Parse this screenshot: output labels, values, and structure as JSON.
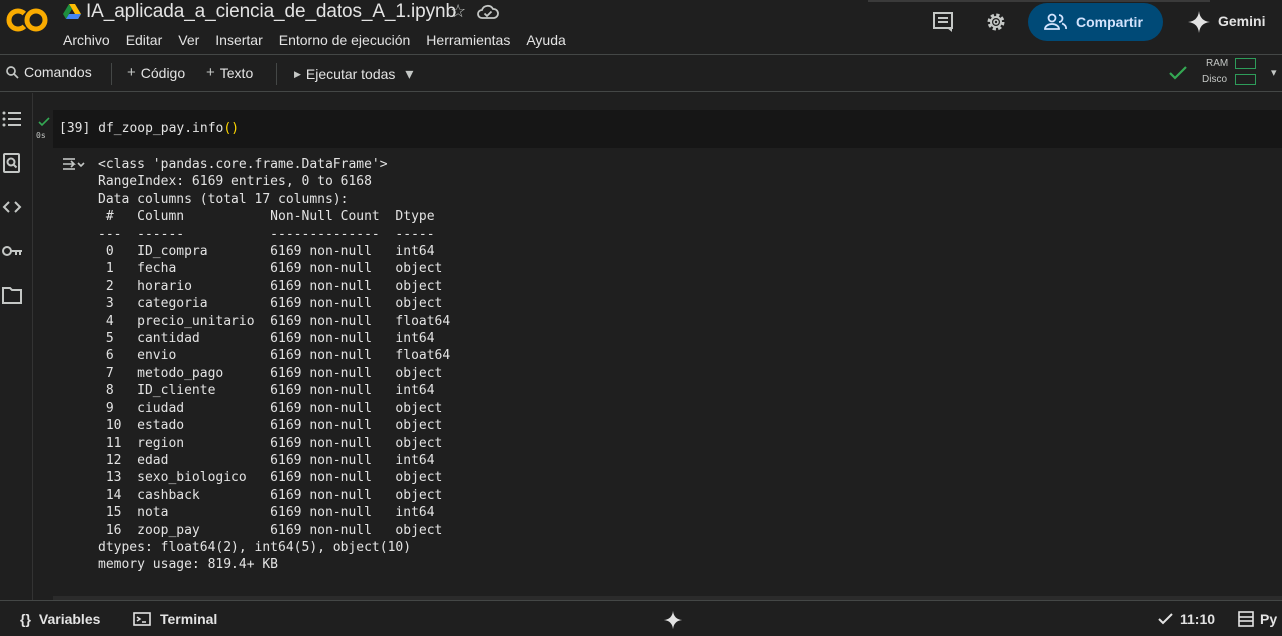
{
  "app": {
    "logo_text": "CO",
    "notebook_title": "IA_aplicada_a_ciencia_de_datos_A_1.ipynb"
  },
  "menu": [
    "Archivo",
    "Editar",
    "Ver",
    "Insertar",
    "Entorno de ejecución",
    "Herramientas",
    "Ayuda"
  ],
  "header": {
    "share_label": "Compartir",
    "gemini_label": "Gemini"
  },
  "toolbar": {
    "commands_label": "Comandos",
    "code_label": "Código",
    "text_label": "Texto",
    "run_all_label": "Ejecutar todas",
    "ram_label": "RAM",
    "disk_label": "Disco"
  },
  "icons": {
    "plus": "+",
    "play": "▶",
    "dropdown": "▾",
    "star": "☆"
  },
  "cell": {
    "exec_count": "[39]",
    "code_prefix": "df_zoop_pay.info",
    "code_parens": "()",
    "exec_time": "0s",
    "output_lines": [
      "<class 'pandas.core.frame.DataFrame'>",
      "RangeIndex: 6169 entries, 0 to 6168",
      "Data columns (total 17 columns):",
      " #   Column           Non-Null Count  Dtype  ",
      "---  ------           --------------  -----  ",
      " 0   ID_compra        6169 non-null   int64  ",
      " 1   fecha            6169 non-null   object ",
      " 2   horario          6169 non-null   object ",
      " 3   categoria        6169 non-null   object ",
      " 4   precio_unitario  6169 non-null   float64",
      " 5   cantidad         6169 non-null   int64  ",
      " 6   envio            6169 non-null   float64",
      " 7   metodo_pago      6169 non-null   object ",
      " 8   ID_cliente       6169 non-null   int64  ",
      " 9   ciudad           6169 non-null   object ",
      " 10  estado           6169 non-null   object ",
      " 11  region           6169 non-null   object ",
      " 12  edad             6169 non-null   int64  ",
      " 13  sexo_biologico   6169 non-null   object ",
      " 14  cashback         6169 non-null   object ",
      " 15  nota             6169 non-null   int64  ",
      " 16  zoop_pay         6169 non-null   object ",
      "dtypes: float64(2), int64(5), object(10)",
      "memory usage: 819.4+ KB"
    ]
  },
  "bottom": {
    "variables_label": "Variables",
    "terminal_label": "Terminal",
    "variables_icon": "{}",
    "time": "11:10",
    "python_label": "Py"
  },
  "colors": {
    "accent_orange": "#f9ab00",
    "share_bg": "#004a77",
    "ok_green": "#34a853",
    "paren_yellow": "#ffd700"
  }
}
